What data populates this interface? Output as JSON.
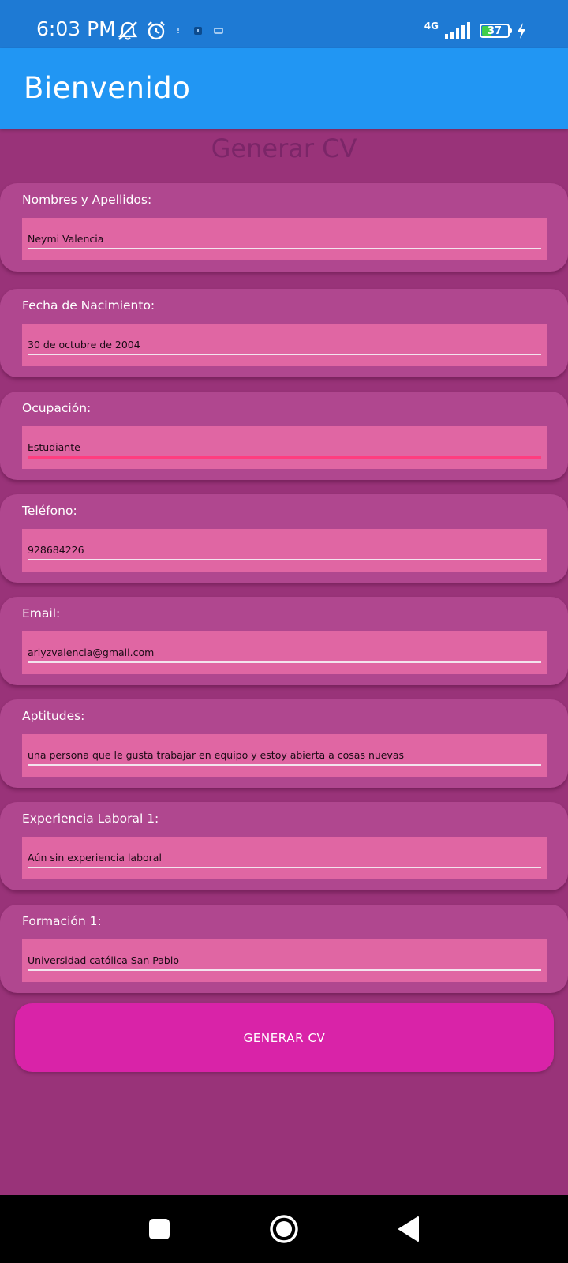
{
  "status_bar": {
    "time": "6:03 PM",
    "network": "4G",
    "battery": "37",
    "icons": [
      "muted-bell-icon",
      "alarm-icon",
      "notification-icon",
      "signal-icon",
      "battery-icon",
      "charging-icon"
    ]
  },
  "app_bar": {
    "title": "Bienvenido",
    "color": "#2196f3"
  },
  "page": {
    "title": "Generar CV"
  },
  "form": {
    "fields": [
      {
        "label": "Nombres y Apellidos:",
        "value": "Neymi Valencia"
      },
      {
        "label": "Fecha de Nacimiento:",
        "value": "30 de octubre de 2004"
      },
      {
        "label": "Ocupación:",
        "value": "Estudiante",
        "focused": true
      },
      {
        "label": "Teléfono:",
        "value": "928684226"
      },
      {
        "label": "Email:",
        "value": "arlyzvalencia@gmail.com"
      },
      {
        "label": "Aptitudes:",
        "value": "una persona que le gusta trabajar en equipo y estoy abierta a cosas nuevas"
      },
      {
        "label": "Experiencia Laboral 1:",
        "value": "Aún sin experiencia laboral"
      },
      {
        "label": "Formación 1:",
        "value": "Universidad católica San Pablo"
      }
    ],
    "submit_label": "GENERAR CV"
  },
  "colors": {
    "background": "#993379",
    "card": "#b0478f",
    "input": "#e066a3",
    "button": "#d923a8",
    "focus_underline": "#ff3d7f"
  },
  "nav_bar": {
    "buttons": [
      "recents-square-icon",
      "home-circle-icon",
      "back-triangle-icon"
    ]
  }
}
